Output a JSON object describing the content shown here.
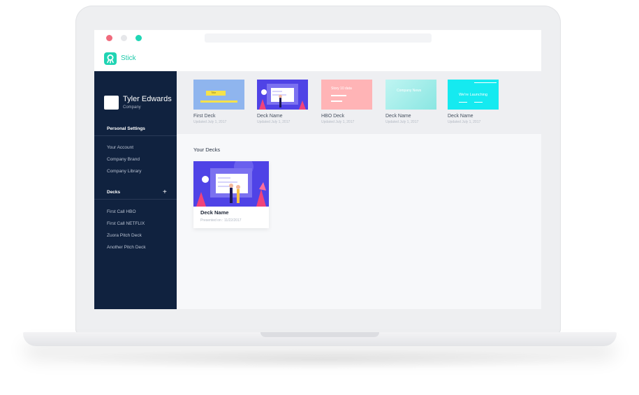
{
  "app": {
    "name": "Stick"
  },
  "user": {
    "name": "Tyler Edwards",
    "company": "Company"
  },
  "sidebar": {
    "personal_settings_title": "Personal Settings",
    "settings_items": [
      "Your Account",
      "Company Brand",
      "Company Library"
    ],
    "decks_title": "Decks",
    "deck_items": [
      "First Call HBO",
      "First Call NETFLIX",
      "Zuora Pitch Deck",
      "Another Pitch Deck"
    ]
  },
  "recent_decks": [
    {
      "title": "First Deck",
      "updated": "Updated July 1, 2017",
      "thumb_text": "Title",
      "thumb_color": "#8fb5ee"
    },
    {
      "title": "Deck Name",
      "updated": "Updated July 1, 2017",
      "thumb_text": "",
      "thumb_color": "#4f43e6"
    },
    {
      "title": "HBO Deck",
      "updated": "Updated July 1, 2017",
      "thumb_text": "Story 10 data",
      "thumb_color": "#ffb4b6"
    },
    {
      "title": "Deck Name",
      "updated": "Updated July 1, 2017",
      "thumb_text": "Company News",
      "thumb_color": "#a6f0ec"
    },
    {
      "title": "Deck Name",
      "updated": "Updated July 1, 2017",
      "thumb_text": "We're Launching",
      "thumb_color": "#15eaf0"
    }
  ],
  "your_decks": {
    "heading": "Your Decks",
    "items": [
      {
        "title": "Deck Name",
        "presented": "Presented on : 11/22/2017"
      }
    ]
  },
  "colors": {
    "sidebar_bg": "#10223f",
    "accent": "#1fd4b3",
    "illustration_bg": "#4f43e6"
  }
}
